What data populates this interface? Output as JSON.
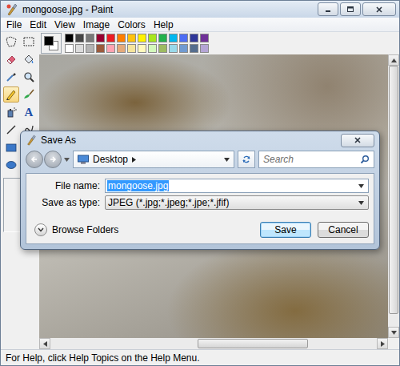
{
  "window": {
    "title": "mongoose.jpg - Paint"
  },
  "menu": [
    {
      "label": "File"
    },
    {
      "label": "Edit"
    },
    {
      "label": "View"
    },
    {
      "label": "Image"
    },
    {
      "label": "Colors"
    },
    {
      "label": "Help"
    }
  ],
  "tools": [
    {
      "kind": "free-select",
      "selected": false
    },
    {
      "kind": "select",
      "selected": false
    },
    {
      "kind": "eraser",
      "selected": false
    },
    {
      "kind": "fill",
      "selected": false
    },
    {
      "kind": "picker",
      "selected": false
    },
    {
      "kind": "magnifier",
      "selected": false
    },
    {
      "kind": "pencil",
      "selected": true
    },
    {
      "kind": "brush",
      "selected": false
    },
    {
      "kind": "airbrush",
      "selected": false
    },
    {
      "kind": "text",
      "glyph": "A",
      "selected": false
    },
    {
      "kind": "line",
      "selected": false
    },
    {
      "kind": "curve",
      "selected": false
    },
    {
      "kind": "rectangle",
      "selected": false
    },
    {
      "kind": "polygon",
      "selected": false
    },
    {
      "kind": "ellipse",
      "selected": false
    },
    {
      "kind": "rounded-rectangle",
      "selected": false
    }
  ],
  "colors": {
    "foreground": "#000000",
    "background": "#ffffff"
  },
  "palette": [
    {
      "color": "#000000"
    },
    {
      "color": "#464646"
    },
    {
      "color": "#787878"
    },
    {
      "color": "#980030"
    },
    {
      "color": "#ed1c24"
    },
    {
      "color": "#ff7e00"
    },
    {
      "color": "#ffc20e"
    },
    {
      "color": "#fff200"
    },
    {
      "color": "#a8e61d"
    },
    {
      "color": "#22b14c"
    },
    {
      "color": "#00b7ef"
    },
    {
      "color": "#4d6df3"
    },
    {
      "color": "#2f3699"
    },
    {
      "color": "#6f3198"
    },
    {
      "color": "#ffffff"
    },
    {
      "color": "#dcdcdc"
    },
    {
      "color": "#b4b4b4"
    },
    {
      "color": "#9c5a3c"
    },
    {
      "color": "#ffa3b1"
    },
    {
      "color": "#e5aa7a"
    },
    {
      "color": "#f5e49c"
    },
    {
      "color": "#fff9bd"
    },
    {
      "color": "#d3f9bc"
    },
    {
      "color": "#9dbb61"
    },
    {
      "color": "#99d9ea"
    },
    {
      "color": "#709ad1"
    },
    {
      "color": "#546d8e"
    },
    {
      "color": "#b5a5d5"
    }
  ],
  "scrollbars": {
    "vertical": {
      "offset": 0.0,
      "level": 0.95
    },
    "horizontal": {
      "offset": 0.45,
      "level": 0.34
    }
  },
  "status_bar": {
    "text": "For Help, click Help Topics on the Help Menu."
  },
  "dialog": {
    "title": "Save As",
    "location": "Desktop",
    "search_placeholder": "Search",
    "file_name_label": "File name:",
    "file_name": "mongoose.jpg",
    "file_name_selected": true,
    "type_label": "Save as type:",
    "type_value": "JPEG (*.jpg;*.jpeg;*.jpe;*.jfif)",
    "browse_folders": "Browse Folders",
    "buttons": [
      {
        "label": "Save",
        "default": true
      },
      {
        "label": "Cancel",
        "default": false
      }
    ]
  }
}
